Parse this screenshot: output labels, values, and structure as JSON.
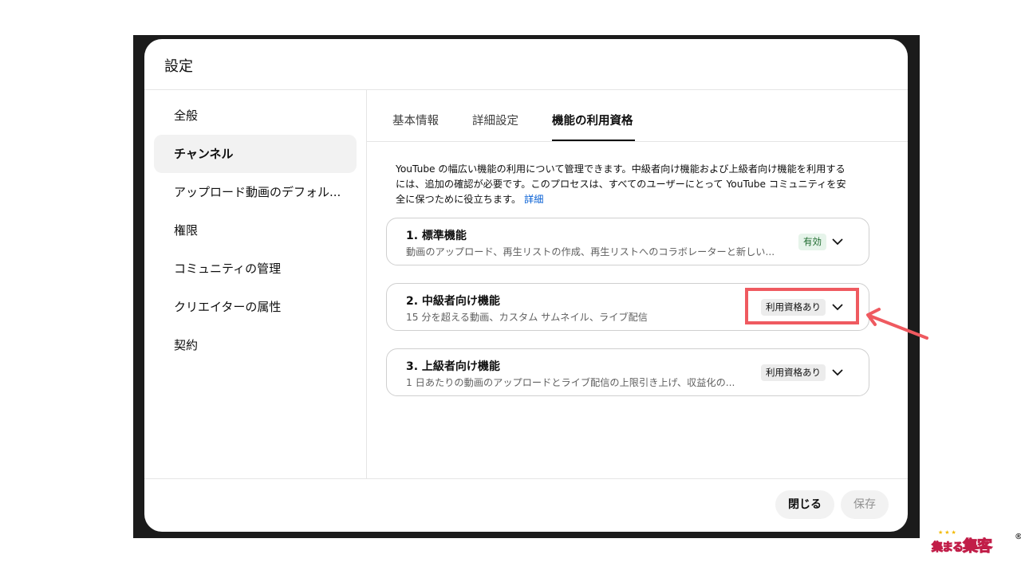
{
  "dialog": {
    "title": "設定"
  },
  "sidebar": {
    "items": [
      {
        "label": "全般"
      },
      {
        "label": "チャンネル"
      },
      {
        "label": "アップロード動画のデフォル..."
      },
      {
        "label": "権限"
      },
      {
        "label": "コミュニティの管理"
      },
      {
        "label": "クリエイターの属性"
      },
      {
        "label": "契約"
      }
    ],
    "active_index": 1
  },
  "tabs": [
    {
      "label": "基本情報"
    },
    {
      "label": "詳細設定"
    },
    {
      "label": "機能の利用資格"
    }
  ],
  "intro": {
    "text": "YouTube の幅広い機能の利用について管理できます。中級者向け機能および上級者向け機能を利用するには、追加の確認が必要です。このプロセスは、すべてのユーザーにとって YouTube コミュニティを安全に保つために役立ちます。",
    "link": "詳細"
  },
  "features": [
    {
      "title": "1. 標準機能",
      "description": "動画のアップロード、再生リストの作成、再生リストへのコラボレーターと新しい...",
      "status": "有効",
      "status_color": "#e6f4ea"
    },
    {
      "title": "2. 中級者向け機能",
      "description": "15 分を超える動画、カスタム サムネイル、ライブ配信",
      "status": "利用資格あり",
      "status_color": "#ececec"
    },
    {
      "title": "3. 上級者向け機能",
      "description": "1 日あたりの動画のアップロードとライブ配信の上限引き上げ、収益化の...",
      "status": "利用資格あり",
      "status_color": "#ececec"
    }
  ],
  "footer": {
    "close_label": "閉じる",
    "save_label": "保存"
  },
  "annotation": {
    "highlight_color": "#ef5a60"
  },
  "watermark": {
    "text_small": "集まる",
    "text_large": "集客",
    "mark": "®"
  }
}
